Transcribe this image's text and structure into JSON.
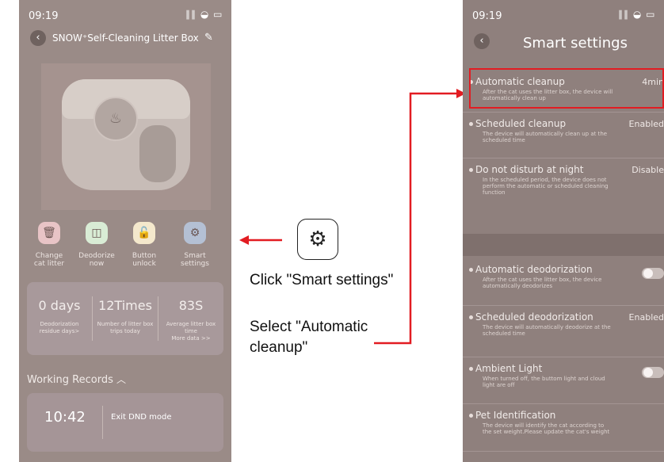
{
  "left_phone": {
    "status_time": "09:19",
    "status_icons": "∥∥ ◒ ▭",
    "title": "SNOW⁺Self-Cleaning Litter Box",
    "actions": [
      {
        "label": "Change\ncat litter",
        "icon": "🗑"
      },
      {
        "label": "Deodorize\nnow",
        "icon": "◫"
      },
      {
        "label": "Button\nunlock",
        "icon": "🔓"
      },
      {
        "label": "Smart\nsettings",
        "icon": "⚙"
      }
    ],
    "stats": [
      {
        "value": "0 days",
        "label": "Deodorization residue days>"
      },
      {
        "value": "12Times",
        "label": "Number of litter box trips today"
      },
      {
        "value": "83S",
        "label": "Average litter box time\nMore data >>"
      }
    ],
    "working_records_title": "Working Records",
    "record": {
      "time": "10:42",
      "text": "Exit DND mode"
    },
    "colors": {
      "change_bg": "#e8c4c6",
      "deodorize_bg": "#d9ecd5",
      "unlock_bg": "#f4e8cc",
      "smart_bg": "#b4c0d4"
    }
  },
  "right_phone": {
    "status_time": "09:19",
    "status_icons": "∥∥ ◒ ▭",
    "title": "Smart settings",
    "settings": [
      {
        "title": "Automatic cleanup",
        "desc": "After the cat uses the litter box, the device will automatically clean up",
        "value": "4min",
        "control": "value"
      },
      {
        "title": "Scheduled cleanup",
        "desc": "The device will automatically clean up at the scheduled time",
        "value": "Enabled",
        "control": "value"
      },
      {
        "title": "Do not disturb at night",
        "desc": "In the scheduled period, the device does not perform the automatic or scheduled cleaning function",
        "value": "Disable",
        "control": "value"
      },
      {
        "title": "Automatic deodorization",
        "desc": "After the cat uses the litter box, the device automatically deodorizes",
        "value": "",
        "control": "toggle"
      },
      {
        "title": "Scheduled deodorization",
        "desc": "The device will automatically deodorize at the scheduled time",
        "value": "Enabled",
        "control": "value"
      },
      {
        "title": "Ambient Light",
        "desc": "When turned off, the buttom light and cloud light are off",
        "value": "",
        "control": "toggle"
      },
      {
        "title": "Pet Identification",
        "desc": "The device will identify the cat according to the set weight.Please update the cat's weight",
        "value": "",
        "control": "none"
      }
    ]
  },
  "annotations": {
    "click_text": "Click \"Smart settings\"",
    "select_text": "Select \"Automatic cleanup\"",
    "accent": "#e21c22"
  }
}
